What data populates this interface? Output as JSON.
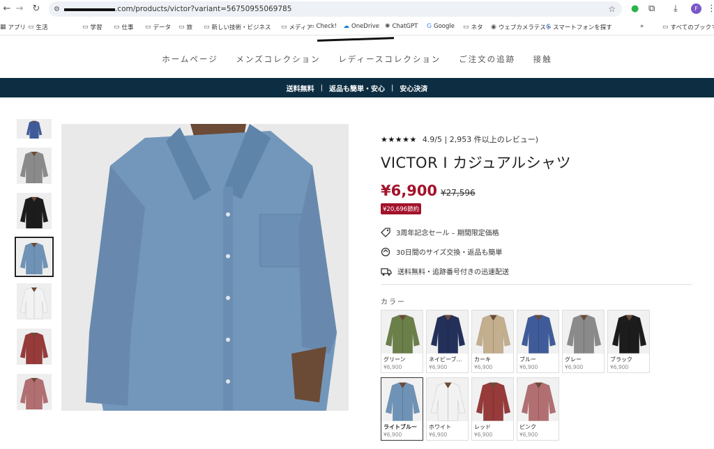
{
  "browser": {
    "url_visible": ".com/products/victor?variant=56750955069785",
    "avatar_letter": "F",
    "bookmarks": [
      {
        "label": "アプリ",
        "icon": "apps-grid-icon"
      },
      {
        "label": "生活",
        "icon": "folder-icon"
      },
      {
        "label": "学習",
        "icon": "folder-icon"
      },
      {
        "label": "仕事",
        "icon": "folder-icon"
      },
      {
        "label": "データ",
        "icon": "folder-icon"
      },
      {
        "label": "旅",
        "icon": "folder-icon"
      },
      {
        "label": "新しい技術・ビジネス",
        "icon": "folder-icon"
      },
      {
        "label": "メディア",
        "icon": "folder-icon"
      },
      {
        "label": "Check!",
        "icon": "folder-icon"
      },
      {
        "label": "OneDrive",
        "icon": "onedrive-icon"
      },
      {
        "label": "ChatGPT",
        "icon": "chatgpt-icon"
      },
      {
        "label": "Google",
        "icon": "google-icon"
      },
      {
        "label": "ネタ",
        "icon": "folder-icon"
      },
      {
        "label": "ウェブカメラテスト",
        "icon": "webcam-icon"
      },
      {
        "label": "スマートフォンを探す",
        "icon": "google-icon"
      }
    ],
    "all_bookmarks": "すべてのブックマーク"
  },
  "nav": [
    "ホームページ",
    "メンズコレクション",
    "レディースコレクション",
    "ご注文の追跡",
    "接触"
  ],
  "banner": [
    "送料無料",
    "返品も簡単・安心",
    "安心決済"
  ],
  "product": {
    "rating": "4.9/5 | 2,953 件以上のレビュー)",
    "title": "VICTOR I カジュアルシャツ",
    "price": "¥6,900",
    "compare_price": "¥27,596",
    "save": "¥20,696節約",
    "features": [
      "3周年記念セール – 期間限定価格",
      "30日間のサイズ交換・返品も簡単",
      "送料無料・追跡番号付きの迅速配送"
    ],
    "color_label": "カラー",
    "colors": [
      {
        "name": "グリーン",
        "price": "¥6,900",
        "hex": "#6b7f49"
      },
      {
        "name": "ネイビーブ…",
        "price": "¥6,900",
        "hex": "#23305a"
      },
      {
        "name": "カーキ",
        "price": "¥6,900",
        "hex": "#c3ae8d"
      },
      {
        "name": "ブルー",
        "price": "¥6,900",
        "hex": "#3f5b9a"
      },
      {
        "name": "グレー",
        "price": "¥6,900",
        "hex": "#8a8a8a"
      },
      {
        "name": "ブラック",
        "price": "¥6,900",
        "hex": "#1c1c1c"
      },
      {
        "name": "ライトブルー",
        "price": "¥6,900",
        "hex": "#6f93b7"
      },
      {
        "name": "ホワイト",
        "price": "¥6,900",
        "hex": "#f2f2f2"
      },
      {
        "name": "レッド",
        "price": "¥6,900",
        "hex": "#973a3a"
      },
      {
        "name": "ピンク",
        "price": "¥6,900",
        "hex": "#b26f72"
      }
    ],
    "thumbnails": [
      "#3f5b9a",
      "#8a8a8a",
      "#1c1c1c",
      "#6f93b7",
      "#f2f2f2",
      "#973a3a",
      "#b26f72"
    ],
    "selected_color": "ライトブルー"
  }
}
